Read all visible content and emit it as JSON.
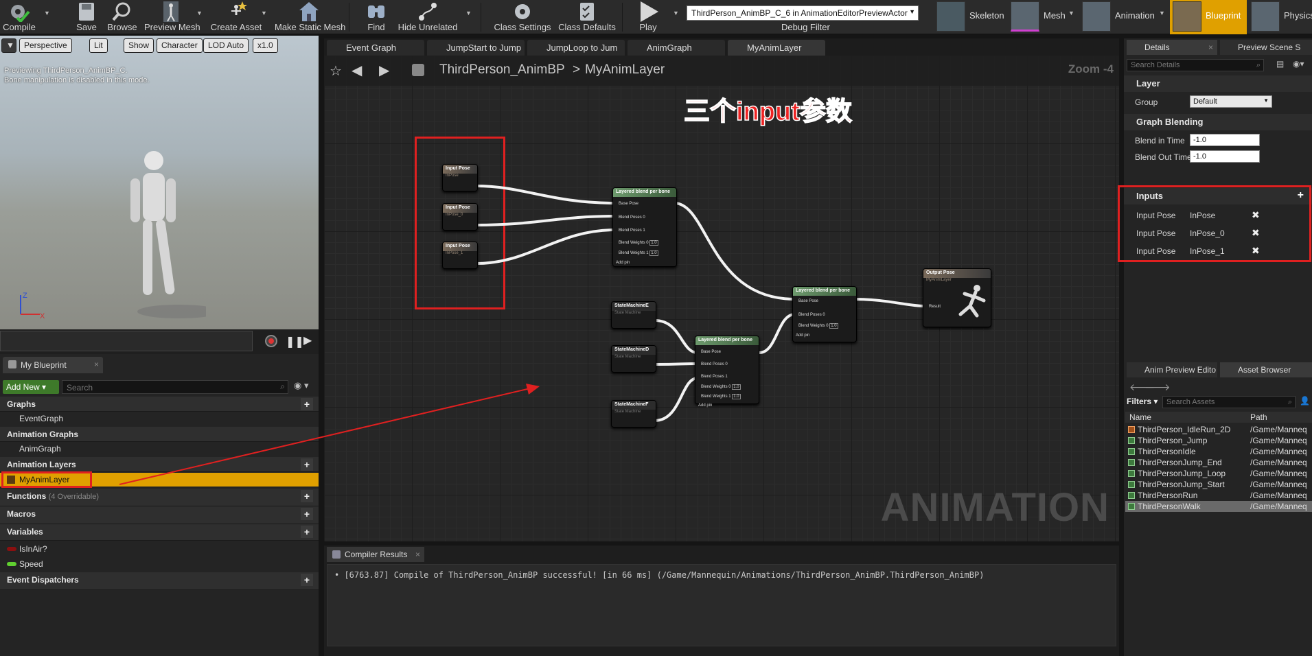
{
  "toolbar": {
    "compile": "Compile",
    "save": "Save",
    "browse": "Browse",
    "preview_mesh": "Preview Mesh",
    "create_asset": "Create Asset",
    "make_static_mesh": "Make Static Mesh",
    "find": "Find",
    "hide_unrelated": "Hide Unrelated",
    "class_settings": "Class Settings",
    "class_defaults": "Class Defaults",
    "play": "Play",
    "debug_select": "ThirdPerson_AnimBP_C_6 in AnimationEditorPreviewActor",
    "debug_filter": "Debug Filter"
  },
  "modes": {
    "skeleton": "Skeleton",
    "mesh": "Mesh",
    "animation": "Animation",
    "blueprint": "Blueprint",
    "physics": "Physics"
  },
  "viewport": {
    "perspective": "Perspective",
    "lit": "Lit",
    "show": "Show",
    "character": "Character",
    "lod": "LOD Auto",
    "speed": "x1.0",
    "info_line1": "Previewing ThirdPerson_AnimBP_C.",
    "info_line2": "Bone manipulation is disabled in this mode.",
    "axis_z": "Z",
    "axis_x": "X"
  },
  "my_blueprint": {
    "tab": "My Blueprint",
    "add_new": "Add New",
    "search_placeholder": "Search",
    "graphs_header": "Graphs",
    "event_graph": "EventGraph",
    "anim_graphs_header": "Animation Graphs",
    "anim_graph": "AnimGraph",
    "anim_layers_header": "Animation Layers",
    "my_anim_layer": "MyAnimLayer",
    "functions_header": "Functions",
    "functions_note": "(4 Overridable)",
    "macros_header": "Macros",
    "variables_header": "Variables",
    "var_isinair": "IsInAir?",
    "var_speed": "Speed",
    "event_dispatchers_header": "Event Dispatchers"
  },
  "graph_tabs": [
    "Event Graph",
    "JumpStart to Jump",
    "JumpLoop to Jum",
    "AnimGraph",
    "MyAnimLayer"
  ],
  "graph": {
    "breadcrumb_root": "ThirdPerson_AnimBP",
    "breadcrumb_sep": ">",
    "breadcrumb_current": "MyAnimLayer",
    "zoom": "Zoom -4",
    "watermark": "ANIMATION",
    "annotation": "三个input参数",
    "nodes": {
      "input_pose": "Input Pose",
      "input_sub_0": "InPose",
      "input_sub_1": "InPose_0",
      "input_sub_2": "InPose_1",
      "layered_blend": "Layered blend per bone",
      "base_pose": "Base Pose",
      "blend_poses_0": "Blend Poses 0",
      "blend_poses_1": "Blend Poses 1",
      "blend_weights_0": "Blend Weights 0",
      "blend_weights_1": "Blend Weights 1",
      "add_pin": "Add pin",
      "weight_val": "1.0",
      "sm_e": "StateMachineE",
      "sm_d": "StateMachineD",
      "sm_f": "StateMachineF",
      "sm_sub": "State Machine",
      "output_pose": "Output Pose",
      "output_sub": "MyAnimLayer",
      "result": "Result"
    }
  },
  "compiler": {
    "tab": "Compiler Results",
    "message": "[6763.87] Compile of ThirdPerson_AnimBP successful! [in 66 ms] (/Game/Mannequin/Animations/ThirdPerson_AnimBP.ThirdPerson_AnimBP)"
  },
  "details": {
    "tab": "Details",
    "tab2": "Preview Scene S",
    "search_placeholder": "Search Details",
    "layer_header": "Layer",
    "group_label": "Group",
    "group_value": "Default",
    "graph_blending_header": "Graph Blending",
    "blend_in_label": "Blend in Time",
    "blend_in_value": "-1.0",
    "blend_out_label": "Blend Out Time",
    "blend_out_value": "-1.0",
    "inputs_header": "Inputs",
    "inputs": [
      {
        "label": "Input Pose",
        "name": "InPose"
      },
      {
        "label": "Input Pose",
        "name": "InPose_0"
      },
      {
        "label": "Input Pose",
        "name": "InPose_1"
      }
    ]
  },
  "asset_browser": {
    "tab1": "Anim Preview Edito",
    "tab2": "Asset Browser",
    "filters": "Filters",
    "search_placeholder": "Search Assets",
    "col_name": "Name",
    "col_path": "Path",
    "rows": [
      {
        "name": "ThirdPerson_IdleRun_2D",
        "path": "/Game/Manneq"
      },
      {
        "name": "ThirdPerson_Jump",
        "path": "/Game/Manneq"
      },
      {
        "name": "ThirdPersonIdle",
        "path": "/Game/Manneq"
      },
      {
        "name": "ThirdPersonJump_End",
        "path": "/Game/Manneq"
      },
      {
        "name": "ThirdPersonJump_Loop",
        "path": "/Game/Manneq"
      },
      {
        "name": "ThirdPersonJump_Start",
        "path": "/Game/Manneq"
      },
      {
        "name": "ThirdPersonRun",
        "path": "/Game/Manneq"
      },
      {
        "name": "ThirdPersonWalk",
        "path": "/Game/Manneq"
      }
    ]
  },
  "colors": {
    "accent_orange": "#e0a000",
    "annotation_red": "#e02020",
    "blend_header_green": "#6d9a6d"
  }
}
